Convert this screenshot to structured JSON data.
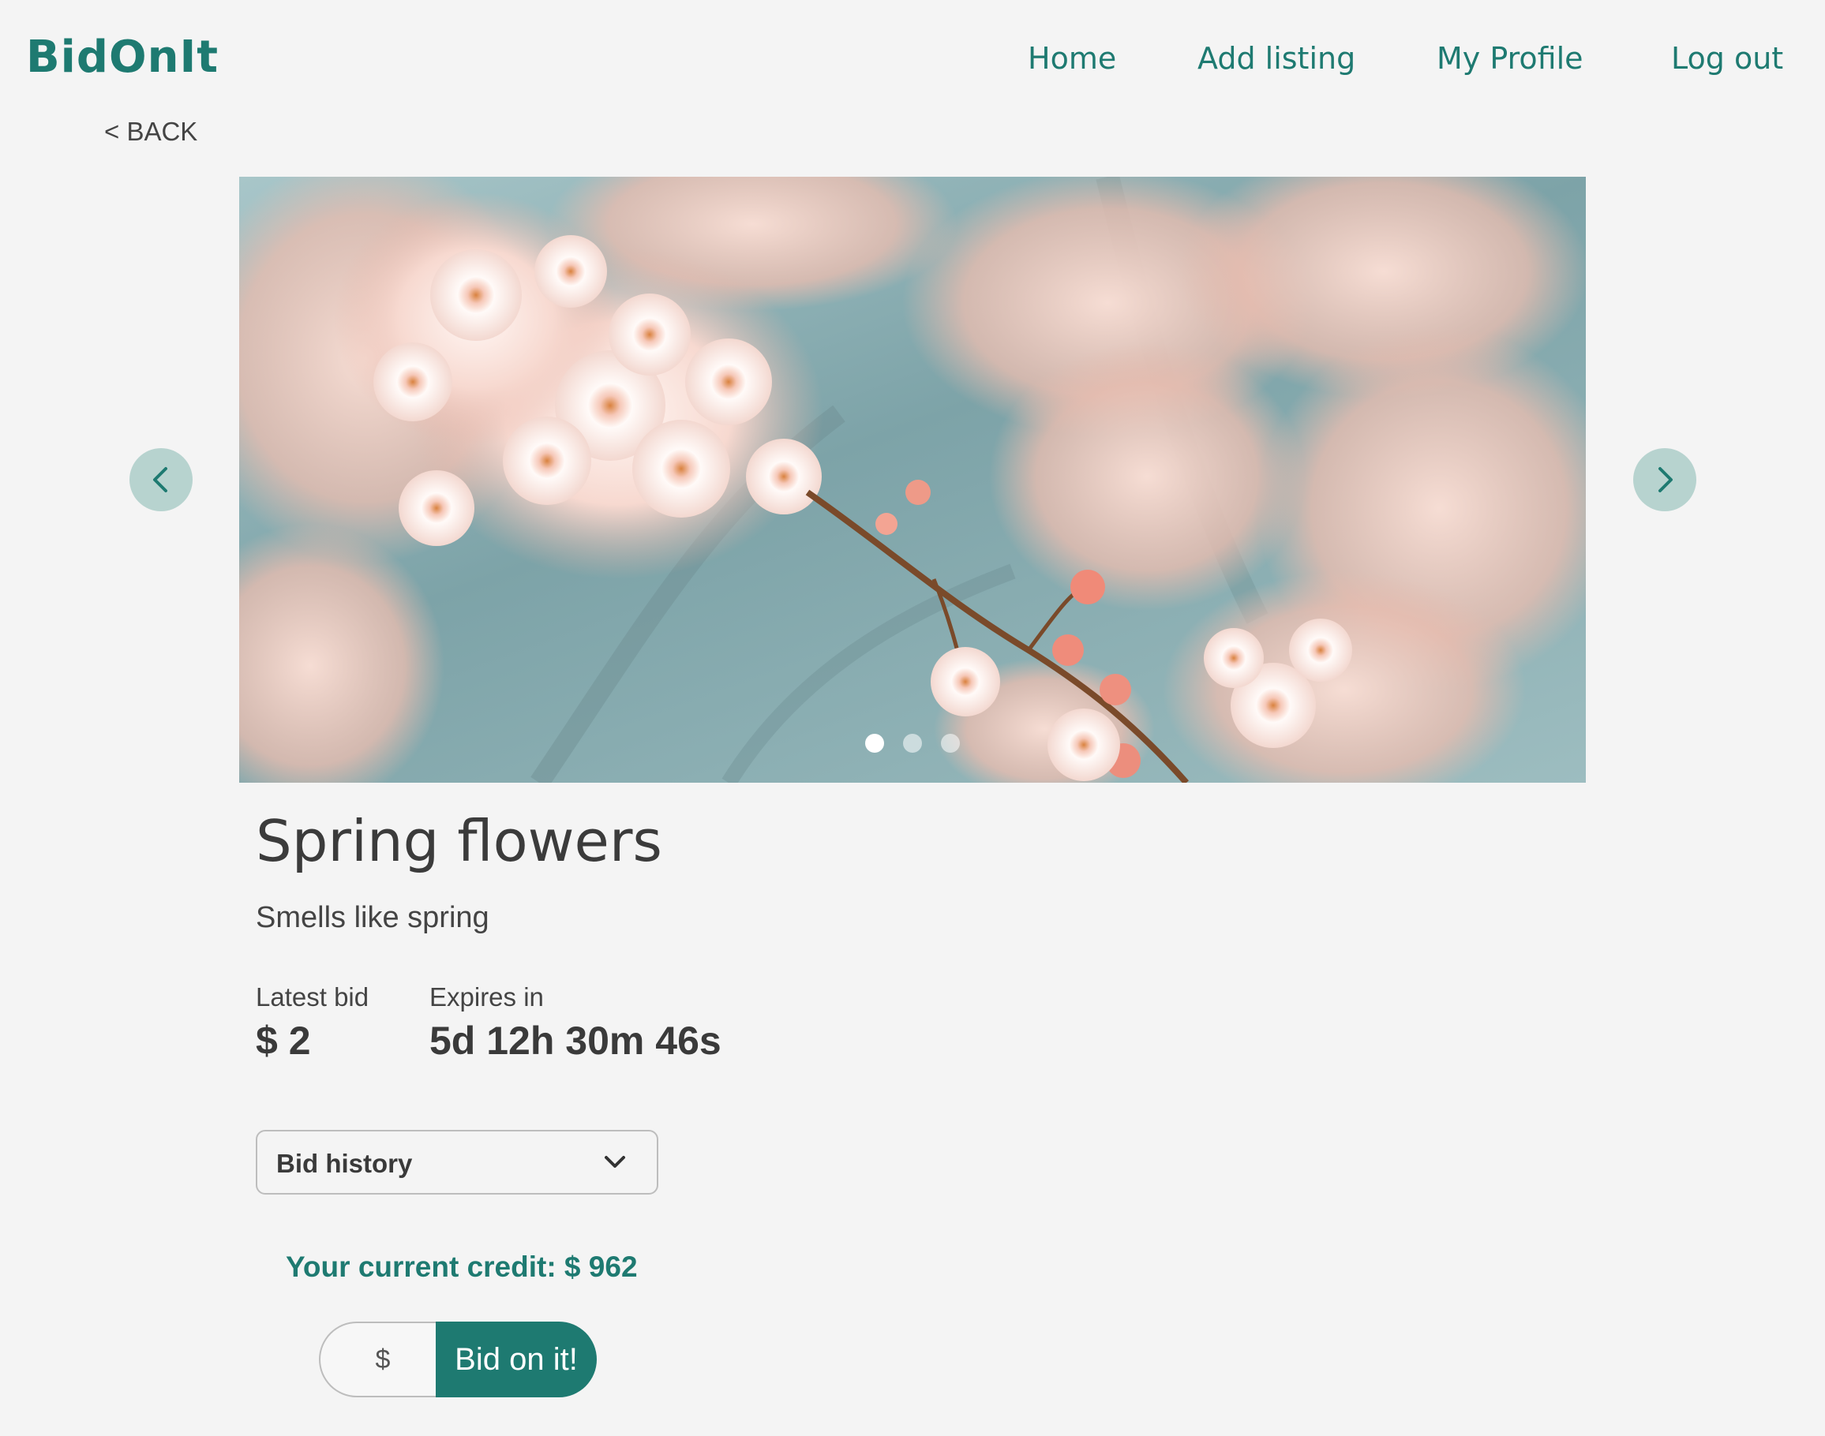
{
  "app": {
    "logo": "BidOnIt"
  },
  "nav": {
    "home": "Home",
    "add_listing": "Add listing",
    "my_profile": "My Profile",
    "log_out": "Log out"
  },
  "back_label": "< BACK",
  "carousel": {
    "slide_count": 3,
    "active_slide": 1
  },
  "listing": {
    "title": "Spring flowers",
    "description": "Smells like spring",
    "latest_bid_label": "Latest bid",
    "latest_bid_value": "$ 2",
    "expires_label": "Expires in",
    "expires_value": "5d 12h 30m 46s"
  },
  "bid_history": {
    "label": "Bid history"
  },
  "credit_text": "Your current credit: $ 962",
  "bid_form": {
    "input_placeholder": "$",
    "button_label": "Bid on it!"
  },
  "colors": {
    "brand": "#1e7a71",
    "arrow_bg": "#b7d3cf",
    "page_bg": "#f4f4f4"
  }
}
